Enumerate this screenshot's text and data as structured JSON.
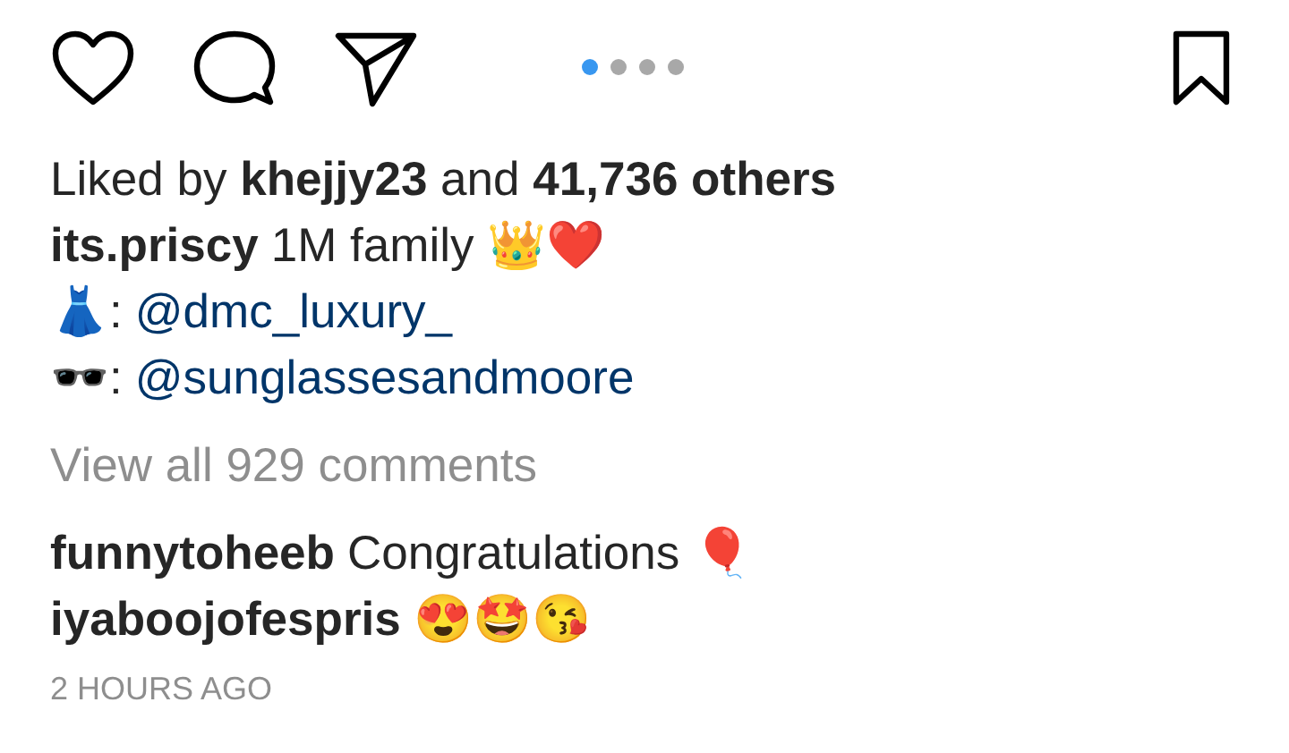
{
  "carousel_dots": [
    {
      "selected": true
    },
    {
      "selected": false
    },
    {
      "selected": false
    },
    {
      "selected": false
    }
  ],
  "likes": "Liked by **khejjy23** and **41,736 others**",
  "caption": {
    "username": "its.priscy",
    "text": "1M family 👑❤️"
  },
  "credits": [
    {
      "prefix": "👗:",
      "mention": "@dmc_luxury_"
    },
    {
      "prefix": "🕶️:",
      "mention": "@sunglassesandmoore"
    }
  ],
  "view_comments": "View all 929 comments",
  "comments": [
    {
      "username": "funnytoheeb",
      "text": "Congratulations 🎈"
    },
    {
      "username": "iyaboojofespris",
      "text": "😍🤩😘"
    }
  ],
  "timestamp": "2 HOURS AGO"
}
